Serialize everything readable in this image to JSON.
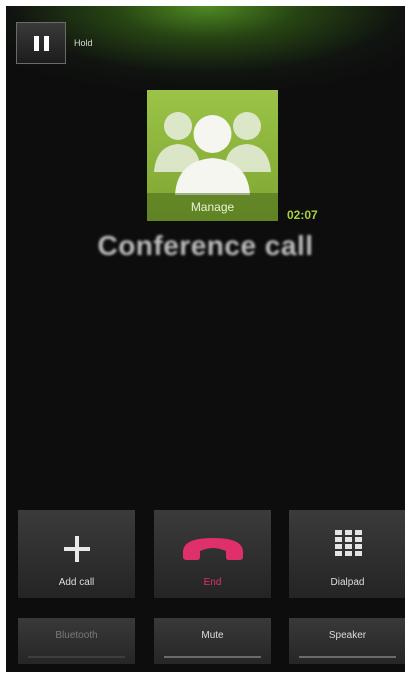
{
  "hold": {
    "label": "Hold",
    "icon": "pause-icon"
  },
  "call": {
    "manage_label": "Manage",
    "timer": "02:07",
    "title": "Conference call",
    "avatar_icon": "group-icon"
  },
  "actions": {
    "add_call": {
      "label": "Add call",
      "icon": "plus-icon"
    },
    "end": {
      "label": "End",
      "icon": "end-call-icon",
      "color": "#e0306b"
    },
    "dialpad": {
      "label": "Dialpad",
      "icon": "dialpad-icon"
    }
  },
  "toggles": {
    "bluetooth": {
      "label": "Bluetooth",
      "enabled": false
    },
    "mute": {
      "label": "Mute"
    },
    "speaker": {
      "label": "Speaker"
    }
  },
  "colors": {
    "accent_green": "#9ac347",
    "timer_green": "#a8d23c",
    "end_red": "#e0306b",
    "background": "#0d0d0d"
  }
}
